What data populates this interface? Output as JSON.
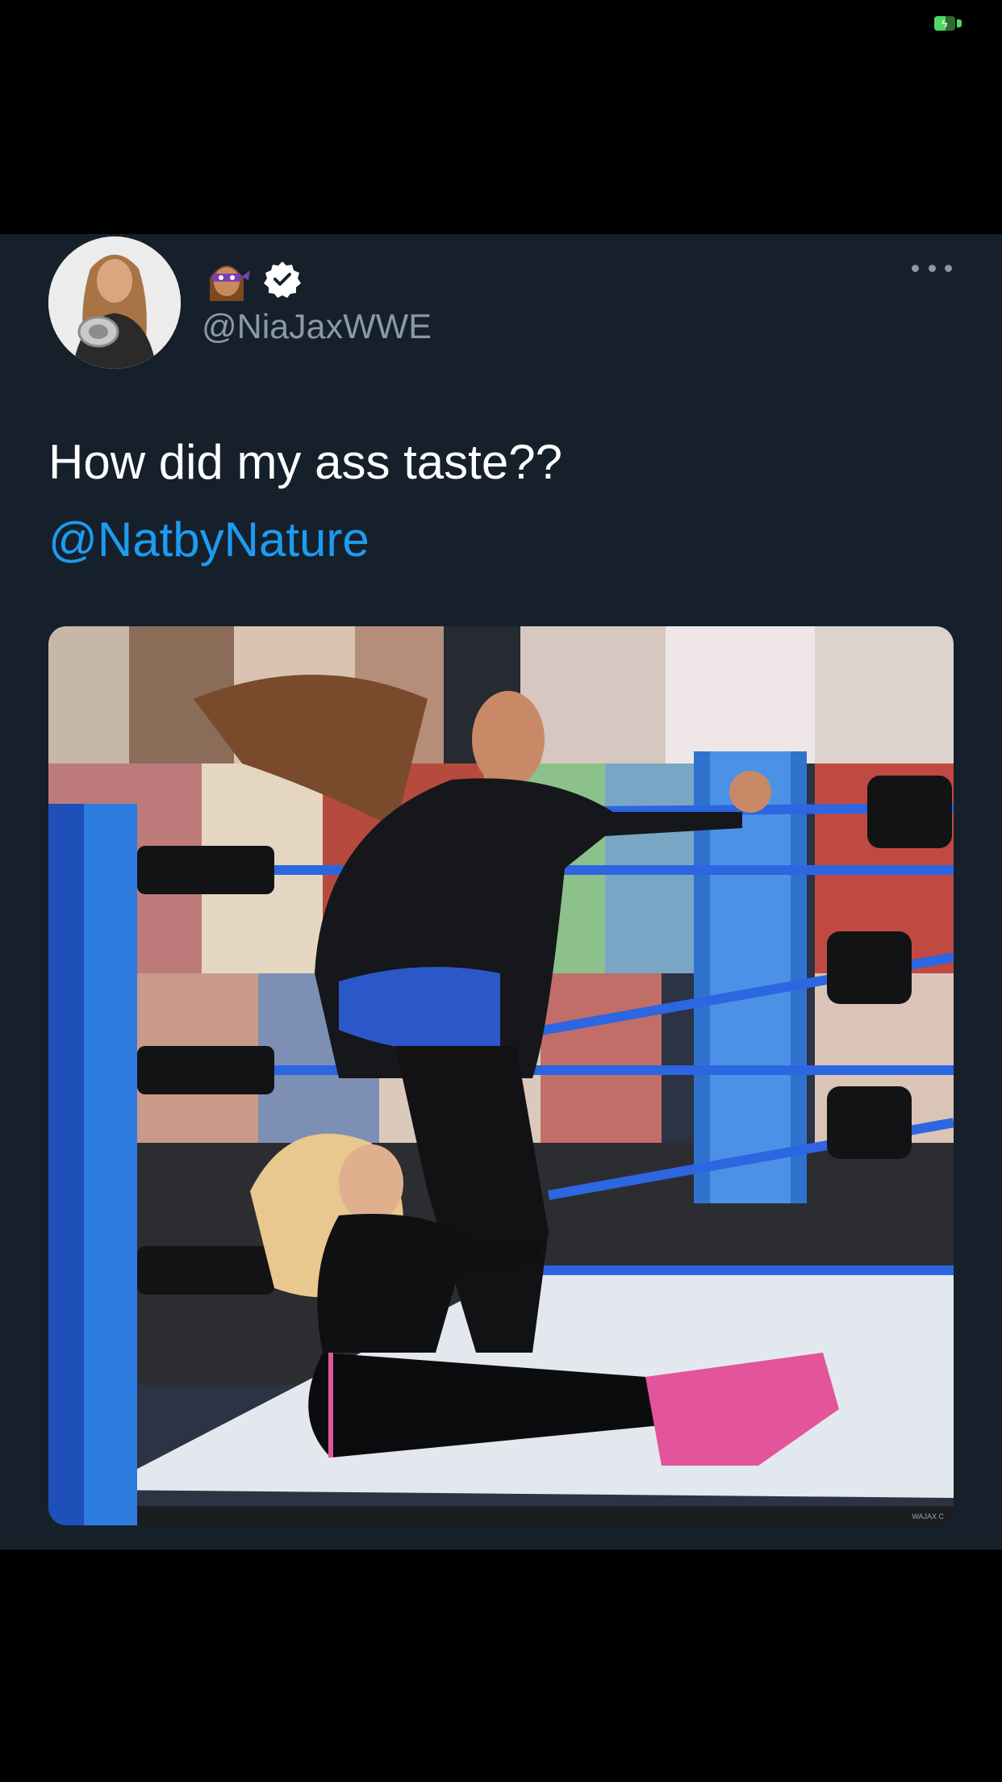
{
  "status_bar": {
    "battery_icon": "battery-charging-icon",
    "battery_color": "#4cd964"
  },
  "tweet": {
    "background": "#15202b",
    "display_name_icon": "woman-ninja-emoji-icon",
    "verified_icon": "verified-badge-icon",
    "handle": "@NiaJaxWWE",
    "more_icon": "more-options-icon",
    "text_line1": "How did my ass taste??",
    "mention": "@NatbyNature",
    "mention_color": "#1d9bf0",
    "media": {
      "description_icon": "wrestling-ring-photo",
      "credit": "WAJAX C"
    }
  }
}
